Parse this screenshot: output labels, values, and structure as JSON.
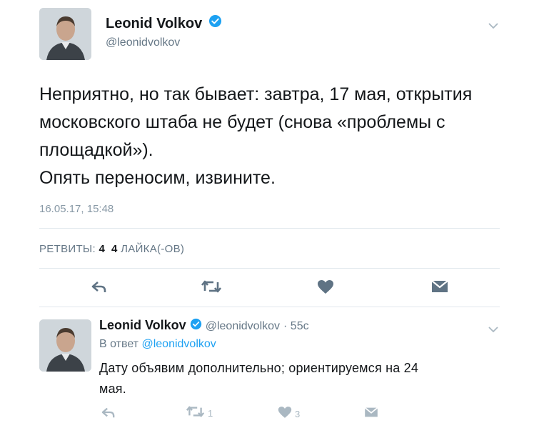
{
  "tweet": {
    "author_name": "Leonid Volkov",
    "author_handle": "@leonidvolkov",
    "text_lines": [
      "Неприятно, но так бывает: завтра, 17 мая, открытия",
      "московского штаба не будет (снова «проблемы с",
      "площадкой»).",
      "Опять переносим, извините."
    ],
    "timestamp": "16.05.17, 15:48",
    "retweets_label": "РЕТВИТЫ:",
    "retweets_count": "4",
    "likes_count": "4",
    "likes_label": "ЛАЙКА(-ОВ)"
  },
  "reply": {
    "author_name": "Leonid Volkov",
    "author_handle": "@leonidvolkov",
    "time": "· 55c",
    "in_reply_prefix": "В ответ",
    "in_reply_handle": "@leonidvolkov",
    "text_lines": [
      "Дату объявим дополнительно; ориентируемся на 24",
      "мая."
    ],
    "retweet_count": "1",
    "like_count": "3"
  },
  "colors": {
    "verified": "#1da1f2",
    "action_icon": "#5f7384",
    "action_icon_light": "#aab8c2",
    "link": "#1da1f2"
  }
}
